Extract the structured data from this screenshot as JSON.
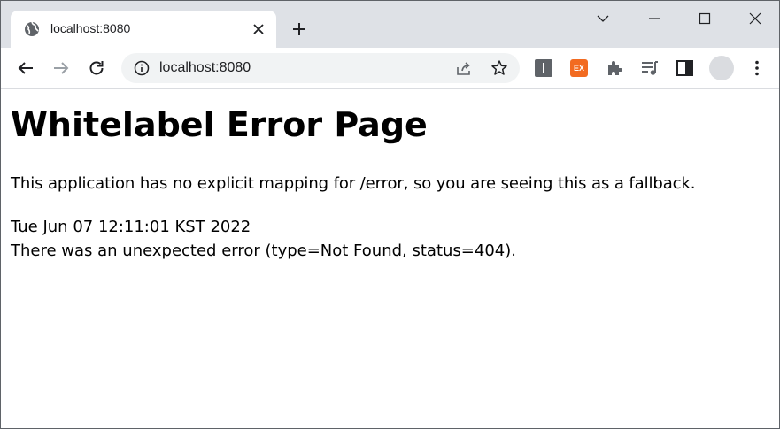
{
  "browser": {
    "tab": {
      "title": "localhost:8080"
    },
    "address_bar": {
      "url": "localhost:8080"
    },
    "icons": {
      "tab": "globe-icon",
      "close": "close-icon",
      "new_tab": "plus-icon",
      "window": [
        "chevron-down-icon",
        "minimize-icon",
        "maximize-icon",
        "close-window-icon"
      ],
      "nav": [
        "back-arrow-icon",
        "forward-arrow-icon",
        "reload-icon"
      ],
      "omnibox": [
        "info-icon",
        "share-icon",
        "star-icon"
      ],
      "extensions": [
        "dark-extension-icon",
        "ex-extension-icon",
        "puzzle-icon",
        "media-queue-icon",
        "side-panel-icon",
        "avatar",
        "more-icon"
      ]
    },
    "extension_badge": "EX",
    "colors": {
      "tabstrip": "#dee1e6",
      "omnibox": "#f1f3f4",
      "ex_badge": "#f26b21"
    }
  },
  "page": {
    "heading": "Whitelabel Error Page",
    "message": "This application has no explicit mapping for /error, so you are seeing this as a fallback.",
    "timestamp": "Tue Jun 07 12:11:01 KST 2022",
    "error_detail": "There was an unexpected error (type=Not Found, status=404)."
  }
}
